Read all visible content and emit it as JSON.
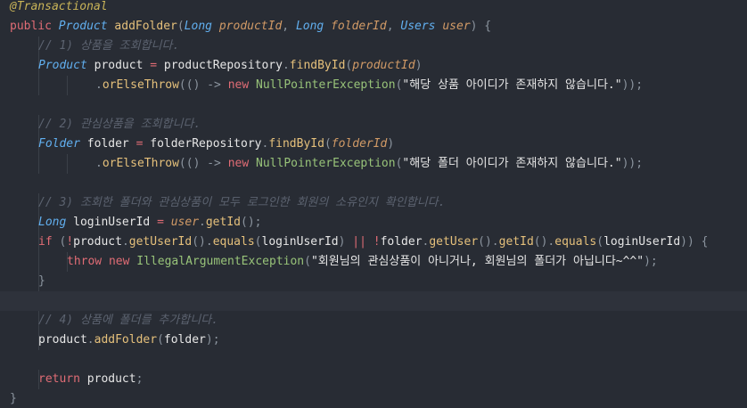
{
  "lines": [
    {
      "tokens": [
        {
          "t": "@Transactional",
          "c": "annotation"
        }
      ]
    },
    {
      "tokens": [
        {
          "t": "public ",
          "c": "kw"
        },
        {
          "t": "Product ",
          "c": "type-i"
        },
        {
          "t": "addFolder",
          "c": "fn"
        },
        {
          "t": "(",
          "c": "punct"
        },
        {
          "t": "Long ",
          "c": "type-i"
        },
        {
          "t": "productId",
          "c": "param"
        },
        {
          "t": ", ",
          "c": "punct"
        },
        {
          "t": "Long ",
          "c": "type-i"
        },
        {
          "t": "folderId",
          "c": "param"
        },
        {
          "t": ", ",
          "c": "punct"
        },
        {
          "t": "Users ",
          "c": "type-i"
        },
        {
          "t": "user",
          "c": "param"
        },
        {
          "t": ") {",
          "c": "punct"
        }
      ]
    },
    {
      "indent": 1,
      "tokens": [
        {
          "t": "// 1) 상품을 조회합니다.",
          "c": "comment"
        }
      ]
    },
    {
      "indent": 1,
      "tokens": [
        {
          "t": "Product ",
          "c": "type-i"
        },
        {
          "t": "product ",
          "c": "plain"
        },
        {
          "t": "= ",
          "c": "op"
        },
        {
          "t": "productRepository",
          "c": "plain"
        },
        {
          "t": ".",
          "c": "punct"
        },
        {
          "t": "findById",
          "c": "fn-y"
        },
        {
          "t": "(",
          "c": "punct"
        },
        {
          "t": "productId",
          "c": "param"
        },
        {
          "t": ")",
          "c": "punct"
        }
      ]
    },
    {
      "indent": 3,
      "tokens": [
        {
          "t": ".",
          "c": "punct"
        },
        {
          "t": "orElseThrow",
          "c": "fn-y"
        },
        {
          "t": "(() -> ",
          "c": "punct"
        },
        {
          "t": "new ",
          "c": "kw"
        },
        {
          "t": "NullPointerException",
          "c": "cls"
        },
        {
          "t": "(",
          "c": "punct"
        },
        {
          "t": "\"해당 상품 아이디가 존재하지 않습니다.\"",
          "c": "str"
        },
        {
          "t": "));",
          "c": "punct"
        }
      ]
    },
    {
      "tokens": []
    },
    {
      "indent": 1,
      "tokens": [
        {
          "t": "// 2) 관심상품을 조회합니다.",
          "c": "comment"
        }
      ]
    },
    {
      "indent": 1,
      "tokens": [
        {
          "t": "Folder ",
          "c": "type-i"
        },
        {
          "t": "folder ",
          "c": "plain"
        },
        {
          "t": "= ",
          "c": "op"
        },
        {
          "t": "folderRepository",
          "c": "plain"
        },
        {
          "t": ".",
          "c": "punct"
        },
        {
          "t": "findById",
          "c": "fn-y"
        },
        {
          "t": "(",
          "c": "punct"
        },
        {
          "t": "folderId",
          "c": "param"
        },
        {
          "t": ")",
          "c": "punct"
        }
      ]
    },
    {
      "indent": 3,
      "tokens": [
        {
          "t": ".",
          "c": "punct"
        },
        {
          "t": "orElseThrow",
          "c": "fn-y"
        },
        {
          "t": "(() -> ",
          "c": "punct"
        },
        {
          "t": "new ",
          "c": "kw"
        },
        {
          "t": "NullPointerException",
          "c": "cls"
        },
        {
          "t": "(",
          "c": "punct"
        },
        {
          "t": "\"해당 폴더 아이디가 존재하지 않습니다.\"",
          "c": "str"
        },
        {
          "t": "));",
          "c": "punct"
        }
      ]
    },
    {
      "tokens": []
    },
    {
      "indent": 1,
      "tokens": [
        {
          "t": "// 3) 조회한 폴더와 관심상품이 모두 로그인한 회원의 소유인지 확인합니다.",
          "c": "comment"
        }
      ]
    },
    {
      "indent": 1,
      "tokens": [
        {
          "t": "Long ",
          "c": "type-i"
        },
        {
          "t": "loginUserId ",
          "c": "plain"
        },
        {
          "t": "= ",
          "c": "op"
        },
        {
          "t": "user",
          "c": "param"
        },
        {
          "t": ".",
          "c": "punct"
        },
        {
          "t": "getId",
          "c": "fn-y"
        },
        {
          "t": "();",
          "c": "punct"
        }
      ]
    },
    {
      "indent": 1,
      "tokens": [
        {
          "t": "if ",
          "c": "kw"
        },
        {
          "t": "(",
          "c": "punct"
        },
        {
          "t": "!",
          "c": "op"
        },
        {
          "t": "product",
          "c": "plain"
        },
        {
          "t": ".",
          "c": "punct"
        },
        {
          "t": "getUserId",
          "c": "fn-y"
        },
        {
          "t": "().",
          "c": "punct"
        },
        {
          "t": "equals",
          "c": "fn-y"
        },
        {
          "t": "(",
          "c": "punct"
        },
        {
          "t": "loginUserId",
          "c": "plain"
        },
        {
          "t": ") ",
          "c": "punct"
        },
        {
          "t": "|| ",
          "c": "op"
        },
        {
          "t": "!",
          "c": "op"
        },
        {
          "t": "folder",
          "c": "plain"
        },
        {
          "t": ".",
          "c": "punct"
        },
        {
          "t": "getUser",
          "c": "fn-y"
        },
        {
          "t": "().",
          "c": "punct"
        },
        {
          "t": "getId",
          "c": "fn-y"
        },
        {
          "t": "().",
          "c": "punct"
        },
        {
          "t": "equals",
          "c": "fn-y"
        },
        {
          "t": "(",
          "c": "punct"
        },
        {
          "t": "loginUserId",
          "c": "plain"
        },
        {
          "t": ")) {",
          "c": "punct"
        }
      ]
    },
    {
      "indent": 2,
      "tokens": [
        {
          "t": "throw ",
          "c": "kw"
        },
        {
          "t": "new ",
          "c": "kw"
        },
        {
          "t": "IllegalArgumentException",
          "c": "cls"
        },
        {
          "t": "(",
          "c": "punct"
        },
        {
          "t": "\"회원님의 관심상품이 아니거나, 회원님의 폴더가 아닙니다~^^\"",
          "c": "str"
        },
        {
          "t": ");",
          "c": "punct"
        }
      ]
    },
    {
      "indent": 1,
      "tokens": [
        {
          "t": "}",
          "c": "punct"
        }
      ]
    },
    {
      "highlight": true,
      "tokens": []
    },
    {
      "indent": 1,
      "tokens": [
        {
          "t": "// 4) 상품에 폴더를 추가합니다.",
          "c": "comment"
        }
      ]
    },
    {
      "indent": 1,
      "tokens": [
        {
          "t": "product",
          "c": "plain"
        },
        {
          "t": ".",
          "c": "punct"
        },
        {
          "t": "addFolder",
          "c": "fn-y"
        },
        {
          "t": "(",
          "c": "punct"
        },
        {
          "t": "folder",
          "c": "plain"
        },
        {
          "t": ");",
          "c": "punct"
        }
      ]
    },
    {
      "tokens": []
    },
    {
      "indent": 1,
      "tokens": [
        {
          "t": "return ",
          "c": "kw"
        },
        {
          "t": "product",
          "c": "plain"
        },
        {
          "t": ";",
          "c": "punct"
        }
      ]
    },
    {
      "tokens": [
        {
          "t": "}",
          "c": "punct"
        }
      ]
    }
  ]
}
